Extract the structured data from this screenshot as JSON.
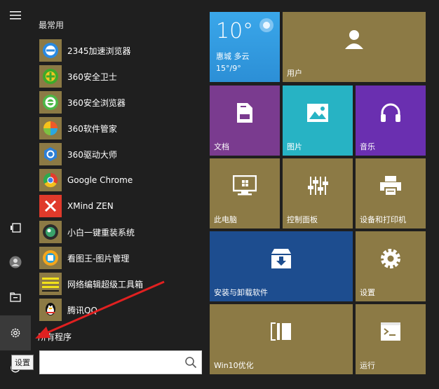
{
  "rail": {
    "settings_tooltip": "设置"
  },
  "list": {
    "section_title": "最常用",
    "apps": [
      {
        "label": "2345加速浏览器"
      },
      {
        "label": "360安全卫士"
      },
      {
        "label": "360安全浏览器"
      },
      {
        "label": "360软件管家"
      },
      {
        "label": "360驱动大师"
      },
      {
        "label": "Google Chrome"
      },
      {
        "label": "XMind ZEN"
      },
      {
        "label": "小白一键重装系统"
      },
      {
        "label": "看图王-图片管理"
      },
      {
        "label": "网络编辑超级工具箱"
      },
      {
        "label": "腾讯QQ"
      }
    ],
    "all_programs": "所有程序",
    "search_placeholder": ""
  },
  "tiles": {
    "weather": {
      "temp": "10°",
      "city": "惠城 多云",
      "range": "15°/9°"
    },
    "user": "用户",
    "documents": "文档",
    "pictures": "图片",
    "music": "音乐",
    "this_pc": "此电脑",
    "control_panel": "控制面板",
    "devices_printers": "设备和打印机",
    "install_uninstall": "安装与卸载软件",
    "settings": "设置",
    "win10_optimize": "Win10优化",
    "run": "运行"
  },
  "colors": {
    "tile_gold": "#8c7a45",
    "tile_purple": "#7a3b8f",
    "tile_cyan": "#27b3c4",
    "tile_violet": "#6a2fb0",
    "tile_blue": "#1d4d8f",
    "weather_top": "#3ca9e8",
    "arrow": "#e02020"
  }
}
